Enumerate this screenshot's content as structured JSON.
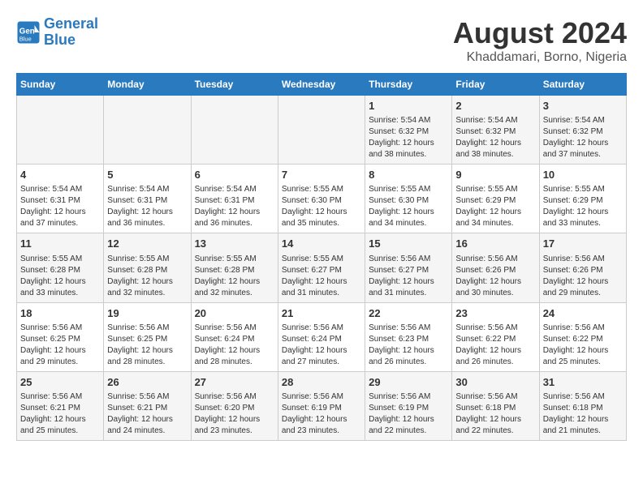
{
  "header": {
    "logo_line1": "General",
    "logo_line2": "Blue",
    "title": "August 2024",
    "subtitle": "Khaddamari, Borno, Nigeria"
  },
  "days_of_week": [
    "Sunday",
    "Monday",
    "Tuesday",
    "Wednesday",
    "Thursday",
    "Friday",
    "Saturday"
  ],
  "weeks": [
    [
      {
        "day": "",
        "info": ""
      },
      {
        "day": "",
        "info": ""
      },
      {
        "day": "",
        "info": ""
      },
      {
        "day": "",
        "info": ""
      },
      {
        "day": "1",
        "info": "Sunrise: 5:54 AM\nSunset: 6:32 PM\nDaylight: 12 hours\nand 38 minutes."
      },
      {
        "day": "2",
        "info": "Sunrise: 5:54 AM\nSunset: 6:32 PM\nDaylight: 12 hours\nand 38 minutes."
      },
      {
        "day": "3",
        "info": "Sunrise: 5:54 AM\nSunset: 6:32 PM\nDaylight: 12 hours\nand 37 minutes."
      }
    ],
    [
      {
        "day": "4",
        "info": "Sunrise: 5:54 AM\nSunset: 6:31 PM\nDaylight: 12 hours\nand 37 minutes."
      },
      {
        "day": "5",
        "info": "Sunrise: 5:54 AM\nSunset: 6:31 PM\nDaylight: 12 hours\nand 36 minutes."
      },
      {
        "day": "6",
        "info": "Sunrise: 5:54 AM\nSunset: 6:31 PM\nDaylight: 12 hours\nand 36 minutes."
      },
      {
        "day": "7",
        "info": "Sunrise: 5:55 AM\nSunset: 6:30 PM\nDaylight: 12 hours\nand 35 minutes."
      },
      {
        "day": "8",
        "info": "Sunrise: 5:55 AM\nSunset: 6:30 PM\nDaylight: 12 hours\nand 34 minutes."
      },
      {
        "day": "9",
        "info": "Sunrise: 5:55 AM\nSunset: 6:29 PM\nDaylight: 12 hours\nand 34 minutes."
      },
      {
        "day": "10",
        "info": "Sunrise: 5:55 AM\nSunset: 6:29 PM\nDaylight: 12 hours\nand 33 minutes."
      }
    ],
    [
      {
        "day": "11",
        "info": "Sunrise: 5:55 AM\nSunset: 6:28 PM\nDaylight: 12 hours\nand 33 minutes."
      },
      {
        "day": "12",
        "info": "Sunrise: 5:55 AM\nSunset: 6:28 PM\nDaylight: 12 hours\nand 32 minutes."
      },
      {
        "day": "13",
        "info": "Sunrise: 5:55 AM\nSunset: 6:28 PM\nDaylight: 12 hours\nand 32 minutes."
      },
      {
        "day": "14",
        "info": "Sunrise: 5:55 AM\nSunset: 6:27 PM\nDaylight: 12 hours\nand 31 minutes."
      },
      {
        "day": "15",
        "info": "Sunrise: 5:56 AM\nSunset: 6:27 PM\nDaylight: 12 hours\nand 31 minutes."
      },
      {
        "day": "16",
        "info": "Sunrise: 5:56 AM\nSunset: 6:26 PM\nDaylight: 12 hours\nand 30 minutes."
      },
      {
        "day": "17",
        "info": "Sunrise: 5:56 AM\nSunset: 6:26 PM\nDaylight: 12 hours\nand 29 minutes."
      }
    ],
    [
      {
        "day": "18",
        "info": "Sunrise: 5:56 AM\nSunset: 6:25 PM\nDaylight: 12 hours\nand 29 minutes."
      },
      {
        "day": "19",
        "info": "Sunrise: 5:56 AM\nSunset: 6:25 PM\nDaylight: 12 hours\nand 28 minutes."
      },
      {
        "day": "20",
        "info": "Sunrise: 5:56 AM\nSunset: 6:24 PM\nDaylight: 12 hours\nand 28 minutes."
      },
      {
        "day": "21",
        "info": "Sunrise: 5:56 AM\nSunset: 6:24 PM\nDaylight: 12 hours\nand 27 minutes."
      },
      {
        "day": "22",
        "info": "Sunrise: 5:56 AM\nSunset: 6:23 PM\nDaylight: 12 hours\nand 26 minutes."
      },
      {
        "day": "23",
        "info": "Sunrise: 5:56 AM\nSunset: 6:22 PM\nDaylight: 12 hours\nand 26 minutes."
      },
      {
        "day": "24",
        "info": "Sunrise: 5:56 AM\nSunset: 6:22 PM\nDaylight: 12 hours\nand 25 minutes."
      }
    ],
    [
      {
        "day": "25",
        "info": "Sunrise: 5:56 AM\nSunset: 6:21 PM\nDaylight: 12 hours\nand 25 minutes."
      },
      {
        "day": "26",
        "info": "Sunrise: 5:56 AM\nSunset: 6:21 PM\nDaylight: 12 hours\nand 24 minutes."
      },
      {
        "day": "27",
        "info": "Sunrise: 5:56 AM\nSunset: 6:20 PM\nDaylight: 12 hours\nand 23 minutes."
      },
      {
        "day": "28",
        "info": "Sunrise: 5:56 AM\nSunset: 6:19 PM\nDaylight: 12 hours\nand 23 minutes."
      },
      {
        "day": "29",
        "info": "Sunrise: 5:56 AM\nSunset: 6:19 PM\nDaylight: 12 hours\nand 22 minutes."
      },
      {
        "day": "30",
        "info": "Sunrise: 5:56 AM\nSunset: 6:18 PM\nDaylight: 12 hours\nand 22 minutes."
      },
      {
        "day": "31",
        "info": "Sunrise: 5:56 AM\nSunset: 6:18 PM\nDaylight: 12 hours\nand 21 minutes."
      }
    ]
  ]
}
